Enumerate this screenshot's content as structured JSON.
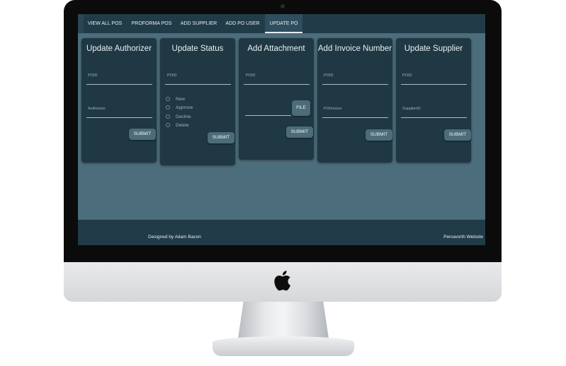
{
  "nav": {
    "tabs": [
      {
        "label": "VIEW ALL POS"
      },
      {
        "label": "PROFORMA POS"
      },
      {
        "label": "ADD SUPPLIER"
      },
      {
        "label": "ADD PO USER"
      },
      {
        "label": "UPDATE PO"
      }
    ],
    "active_tab": "UPDATE PO"
  },
  "cards": {
    "authorizer": {
      "title": "Update Authorizer",
      "poid_placeholder": "POID",
      "authorizer_placeholder": "Authorizer",
      "submit": "SUBMIT"
    },
    "status": {
      "title": "Update Status",
      "poid_placeholder": "POID",
      "options": [
        "New",
        "Approve",
        "Decline",
        "Delete"
      ],
      "submit": "SUBMIT"
    },
    "attachment": {
      "title": "Add Attachment",
      "poid_placeholder": "POID",
      "file_button": "FILE",
      "submit": "SUBMIT"
    },
    "invoice": {
      "title": "Add Invoice Number",
      "poid_placeholder": "POID",
      "invoice_placeholder": "POInvoice",
      "submit": "SUBMIT"
    },
    "supplier": {
      "title": "Update Supplier",
      "poid_placeholder": "POID",
      "supplier_placeholder": "SupplierID",
      "submit": "SUBMIT"
    }
  },
  "footer": {
    "credit": "Designed by Adam Bacon",
    "link": "Pensworth Website"
  },
  "colors": {
    "nav_bg": "#223b48",
    "page_bg": "#4c6d7b",
    "card_bg": "#1f3844",
    "button_bg": "#4d6c7a"
  },
  "icons": {
    "device_logo": "apple-logo-icon"
  }
}
